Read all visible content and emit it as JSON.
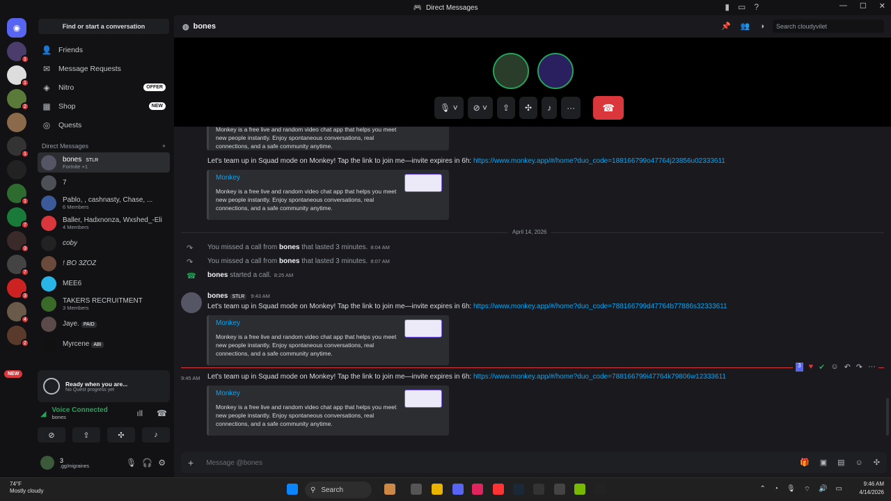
{
  "window": {
    "title": "Direct Messages"
  },
  "sidebar": {
    "find_label": "Find or start a conversation",
    "nav": [
      {
        "label": "Friends",
        "icon": "friends-icon"
      },
      {
        "label": "Message Requests",
        "icon": "mail-icon"
      },
      {
        "label": "Nitro",
        "icon": "nitro-icon",
        "pill": "OFFER"
      },
      {
        "label": "Shop",
        "icon": "shop-icon",
        "pill": "NEW"
      },
      {
        "label": "Quests",
        "icon": "quests-icon"
      }
    ],
    "dm_header": "Direct Messages",
    "dms": [
      {
        "name": "bones",
        "tag": "STLR",
        "sub": "Fortnite +1",
        "active": true
      },
      {
        "name": "7",
        "sub": ""
      },
      {
        "name": "Pablo, , cashnasty, Chase, ...",
        "sub": "6 Members"
      },
      {
        "name": "Baller, Hadxnonza, Wxshed_-Eli",
        "sub": "4 Members"
      },
      {
        "name": "coby",
        "sub": ""
      },
      {
        "name": "! BO 3ZOZ",
        "sub": ""
      },
      {
        "name": "MEE6",
        "sub": ""
      },
      {
        "name": "TAKERS RECRUITMENT",
        "sub": "3 Members"
      },
      {
        "name": "Jaye.",
        "tag": "PAID",
        "sub": ""
      },
      {
        "name": "Myrcene",
        "tag": "ABI",
        "sub": ""
      }
    ],
    "guild_new": "NEW",
    "quest": {
      "title": "Ready when you are...",
      "sub": "No Quest progress yet"
    },
    "voice": {
      "status": "Voice Connected",
      "channel": "bones"
    },
    "user": {
      "name": "3",
      "status": ".gg/migraines"
    }
  },
  "channel": {
    "name": "bones",
    "search_placeholder": "Search cloudyvilet"
  },
  "messages": {
    "invite_text": "Let's team up in Squad mode on Monkey! Tap the link to join me—invite expires in 6h:",
    "link1": "https://www.monkey.app/#/home?duo_code=188166799o47764j23856u02333611",
    "link2": "https://www.monkey.app/#/home?duo_code=788166799d47764b77886s32333611",
    "link3": "https://www.monkey.app/#/home?duo_code=788166799i47764k79806w12333611",
    "embed_title": "Monkey",
    "embed_desc": "Monkey is a free live and random video chat app that helps you meet new people instantly. Enjoy spontaneous conversations, real connections, and a safe community anytime.",
    "date": "April 14, 2026",
    "missed1": {
      "pre": "You missed a call from",
      "who": "bones",
      "post": "that lasted 3 minutes.",
      "time": "8:04 AM"
    },
    "missed2": {
      "pre": "You missed a call from",
      "who": "bones",
      "post": "that lasted 3 minutes.",
      "time": "8:07 AM"
    },
    "started": {
      "who": "bones",
      "post": "started a call.",
      "time": "8:25 AM"
    },
    "author": {
      "name": "bones",
      "tag": "STLR",
      "time": "9:43 AM"
    },
    "followup_time": "9:45 AM",
    "hover_count": "3"
  },
  "composer": {
    "placeholder": "Message @bones"
  },
  "taskbar": {
    "weather_temp": "74°F",
    "weather_desc": "Mostly cloudy",
    "search": "Search",
    "time": "9:46 AM",
    "date": "4/14/2026"
  },
  "colors": {
    "accent": "#5865f2",
    "danger": "#da373c",
    "online": "#23a55a",
    "link": "#00a8fc"
  }
}
